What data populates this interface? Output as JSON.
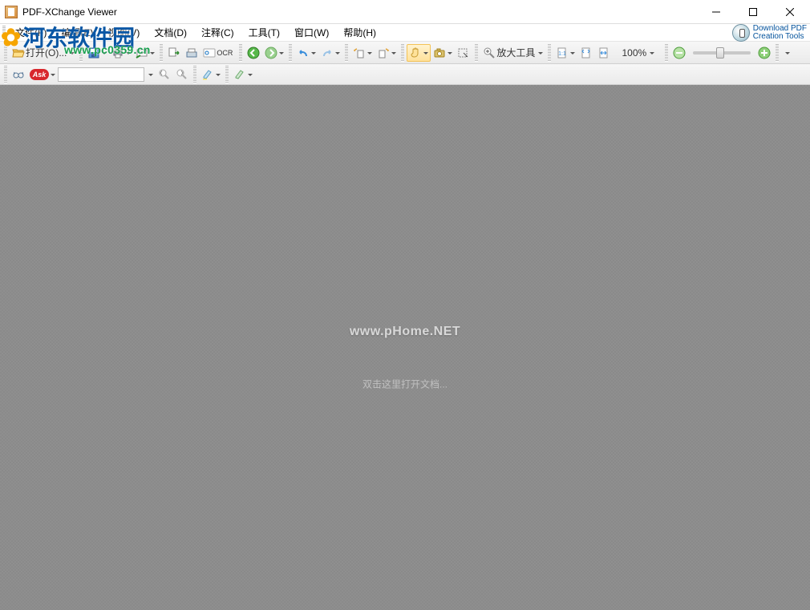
{
  "window": {
    "title": "PDF-XChange Viewer"
  },
  "menu": {
    "file": "文件(F)",
    "edit": "编辑(E)",
    "view": "视图(V)",
    "doc": "文档(D)",
    "comment": "注释(C)",
    "tool": "工具(T)",
    "window": "窗口(W)",
    "help": "帮助(H)",
    "download_line1": "Download PDF",
    "download_line2": "Creation Tools"
  },
  "toolbar": {
    "open_label": "打开(O)...",
    "ocr_label": "OCR",
    "zoom_tool_label": "放大工具",
    "zoom_value": "100%"
  },
  "search_toolbar": {
    "ask_label": "Ask",
    "search_value": ""
  },
  "viewport": {
    "watermark_top": "www.pHome.NET",
    "empty_hint": "双击这里打开文档..."
  },
  "overlay": {
    "logo_text": "河东软件园",
    "logo_url": "www.pc0359.cn"
  },
  "icons": {
    "folder_open": "folder-open-icon",
    "save": "save-icon",
    "print": "print-icon",
    "mail": "mail-send-icon",
    "export": "export-icon",
    "scan": "scan-icon",
    "ocr": "ocr-icon",
    "back": "back-icon",
    "forward": "forward-icon",
    "undo": "undo-icon",
    "redo": "redo-icon",
    "rotate_ccw": "rotate-ccw-icon",
    "rotate_cw": "rotate-cw-icon",
    "hand": "hand-tool-icon",
    "snapshot": "snapshot-icon",
    "select": "select-icon",
    "zoom": "zoom-icon",
    "actual": "actual-size-icon",
    "fit_page": "fit-page-icon",
    "fit_width": "fit-width-icon",
    "zoom_out": "zoom-out-icon",
    "zoom_in": "zoom-in-icon",
    "glasses": "glasses-icon",
    "search_opts": "search-options-icon",
    "highlight": "highlight-icon",
    "highlight_next": "highlight-next-icon",
    "find": "find-icon"
  }
}
